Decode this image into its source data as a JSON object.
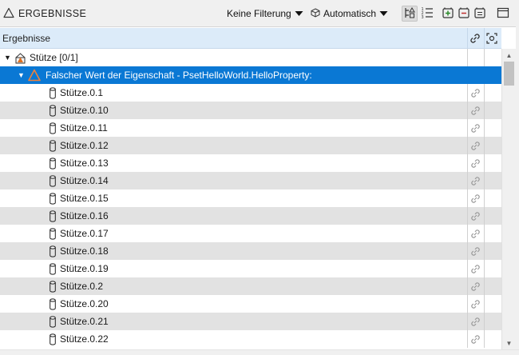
{
  "panel": {
    "title": "ERGEBNISSE",
    "filter_label": "Keine Filterung",
    "mode_label": "Automatisch"
  },
  "columns": {
    "results_header": "Ergebnisse"
  },
  "tree": {
    "root": {
      "label": "Stütze [0/1]",
      "expanded": true,
      "icon": "warning-element-icon"
    },
    "issue": {
      "label": "Falscher Wert der Eigenschaft - PsetHelloWorld.HelloProperty:",
      "expanded": true,
      "selected": true,
      "icon": "warning-triangle-icon"
    },
    "items": [
      "Stütze.0.1",
      "Stütze.0.10",
      "Stütze.0.11",
      "Stütze.0.12",
      "Stütze.0.13",
      "Stütze.0.14",
      "Stütze.0.15",
      "Stütze.0.16",
      "Stütze.0.17",
      "Stütze.0.18",
      "Stütze.0.19",
      "Stütze.0.2",
      "Stütze.0.20",
      "Stütze.0.21",
      "Stütze.0.22"
    ]
  },
  "colors": {
    "selection": "#0a78d4",
    "header_bg": "#dcebf9",
    "alt_row": "#e2e2e2",
    "warning": "#e07020"
  }
}
